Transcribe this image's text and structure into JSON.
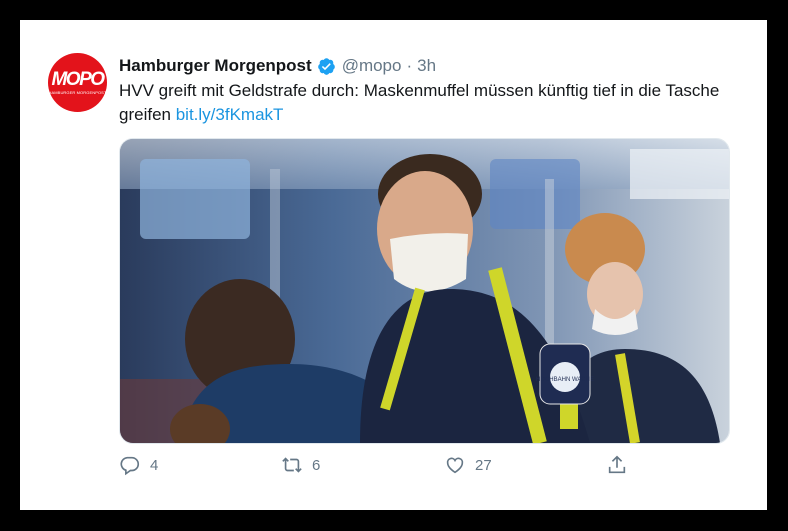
{
  "tweet": {
    "account_name": "Hamburger Morgenpost",
    "handle": "@mopo",
    "separator": "·",
    "time": "3h",
    "text": "HVV greift mit Geldstrafe durch: Maskenmuffel müssen künftig tief in die Tasche greifen",
    "link": "bit.ly/3fKmakT",
    "avatar_logo": "MOPO",
    "avatar_sub": "HAMBURGER MORGENPOST",
    "media_badge_text": "HOCHBAHN WACHE",
    "actions": {
      "reply_count": "4",
      "retweet_count": "6",
      "like_count": "27"
    }
  },
  "icons": [
    "verified-badge-icon",
    "reply-icon",
    "retweet-icon",
    "like-icon",
    "share-icon"
  ],
  "colors": {
    "brand_red": "#e3131b",
    "verified_blue": "#1da1f2",
    "link_blue": "#1b95e0",
    "muted": "#657786"
  }
}
